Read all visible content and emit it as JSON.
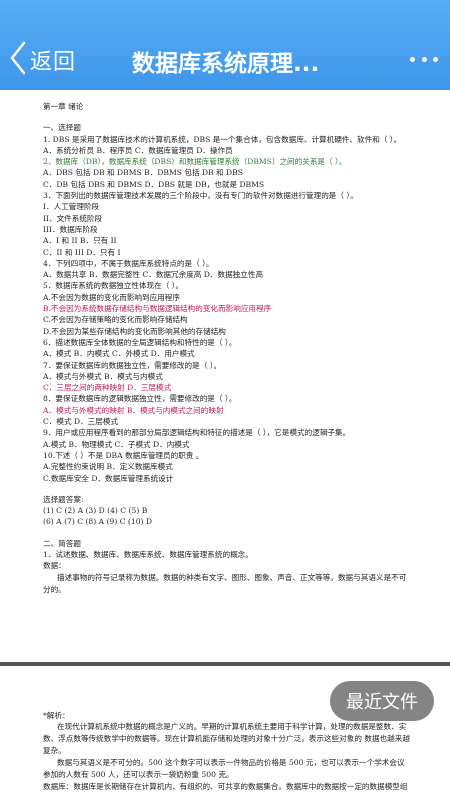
{
  "header": {
    "back_label": "返回",
    "title": "数据库系统原理..."
  },
  "document": {
    "page1_lines": [
      {
        "t": "第一章  绪论",
        "s": ""
      },
      {
        "t": "",
        "s": "gap"
      },
      {
        "t": "一、选择题",
        "s": ""
      },
      {
        "t": "1. DBS 是采用了数据库技术的计算机系统，DBS 是一个集合体，包含数据库、计算机硬件、软件和（  ）。",
        "s": ""
      },
      {
        "t": "A．系统分析员  B．程序员  C．数据库管理员  D．操作员",
        "s": ""
      },
      {
        "t": "2．数据库（DB），数据库系统（DBS）和数据库管理系统（DBMS）之间的关系是（  ）。",
        "s": "green"
      },
      {
        "t": "A．DBS 包括 DB 和 DBMS  B．DBMS 包括 DB 和 DBS",
        "s": ""
      },
      {
        "t": "C．DB 包括 DBS 和 DBMS  D．DBS 就是 DB，也就是 DBMS",
        "s": ""
      },
      {
        "t": "3．下面列出的数据库管理技术发展的三个阶段中，没有专门的软件对数据进行管理的是（  ）。",
        "s": ""
      },
      {
        "t": "I．人工管理阶段",
        "s": ""
      },
      {
        "t": "II．文件系统阶段",
        "s": ""
      },
      {
        "t": "III．数据库阶段",
        "s": ""
      },
      {
        "t": "A．I 和 II  B．只有 II",
        "s": ""
      },
      {
        "t": "C．II 和 III  D．只有 I",
        "s": ""
      },
      {
        "t": "4．下列四项中，不属于数据库系统特点的是（  ）。",
        "s": ""
      },
      {
        "t": "A．数据共享  B．数据完整性  C．数据冗余度高  D．数据独立性高",
        "s": ""
      },
      {
        "t": "5．数据库系统的数据独立性体现在（  ）。",
        "s": ""
      },
      {
        "t": "A.不会因为数据的变化而影响到应用程序",
        "s": ""
      },
      {
        "t": "B.不会因为系统数据存储结构与数据逻辑结构的变化而影响应用程序",
        "s": "ans"
      },
      {
        "t": "C.不会因为存储策略的变化而影响存储结构",
        "s": ""
      },
      {
        "t": "D.不会因为某些存储结构的变化而影响其他的存储结构",
        "s": ""
      },
      {
        "t": "6．描述数据库全体数据的全局逻辑结构和特性的是（  ）。",
        "s": ""
      },
      {
        "t": "A．模式  B．内模式  C．外模式  D．用户模式",
        "s": ""
      },
      {
        "t": "7．要保证数据库的数据独立性，需要修改的是（  ）。",
        "s": ""
      },
      {
        "t": "A．模式与外模式  B．模式与内模式",
        "s": ""
      },
      {
        "t": "C．三层之间的两种映射  D．三层模式",
        "s": "ans"
      },
      {
        "t": "8．要保证数据库的逻辑数据独立性，需要修改的是（  ）。",
        "s": ""
      },
      {
        "t": "A．模式与外模式的映射  B．模式与内模式之间的映射",
        "s": "ans"
      },
      {
        "t": "C．模式  D．三层模式",
        "s": ""
      },
      {
        "t": "9．用户或应用程序看到的那部分局部逻辑结构和特征的描述是（  ），它是模式的逻辑子集。",
        "s": ""
      },
      {
        "t": "A.模式  B．物理模式  C．子模式  D．内模式",
        "s": ""
      },
      {
        "t": "10.下述（  ）不是 DBA 数据库管理员的职责 。",
        "s": ""
      },
      {
        "t": "A.完整性约束说明  B．定义数据库模式",
        "s": ""
      },
      {
        "t": "C.数据库安全  D．数据库管理系统设计",
        "s": ""
      },
      {
        "t": "",
        "s": "gap"
      },
      {
        "t": "选择题答案:",
        "s": ""
      },
      {
        "t": "(1) C (2) A (3) D (4) C (5) B",
        "s": ""
      },
      {
        "t": "(6) A (7) C (8) A (9) C (10) D",
        "s": ""
      },
      {
        "t": "",
        "s": "gap"
      },
      {
        "t": "二、简答题",
        "s": ""
      },
      {
        "t": "1．试述数据、数据库、数据库系统、数据库管理系统的概念。",
        "s": ""
      },
      {
        "t": "数据：",
        "s": ""
      }
    ],
    "page1_para": "描述事物的符号记录称为数据。数据的种类有文字、图形、图象、声音、正文等等。数据与其语义是不可分的。",
    "page2_label": "*解析：",
    "page2_paras": [
      "在现代计算机系统中数据的概念是广义的。早期的计算机系统主要用于科学计算，处理的数据是整数、实数、浮点数等传统数学中的数据等。现在计算机能存储和处理的对象十分广泛，表示这些对象的 数据也越来越复杂。",
      "数据与其语义是不可分的。500 这个数字可以表示一件物品的价格是 500 元，也可以表示一个学术会议参加的人数有 500 人，还可以表示一袋奶粉重 500 克。"
    ],
    "page2_last": "数据库：数据库是长期储存在计算机内、有组织的、可共享的数据集合。数据库中的数据按一定的数据模型组"
  },
  "floating": {
    "recent_label": "最近文件"
  },
  "colors": {
    "header_bg": "#4ba2ef",
    "answer_text": "#c2185b",
    "green_text": "#2e7d32"
  },
  "icons": {
    "back": "chevron-left-icon",
    "more": "more-dots-icon"
  }
}
